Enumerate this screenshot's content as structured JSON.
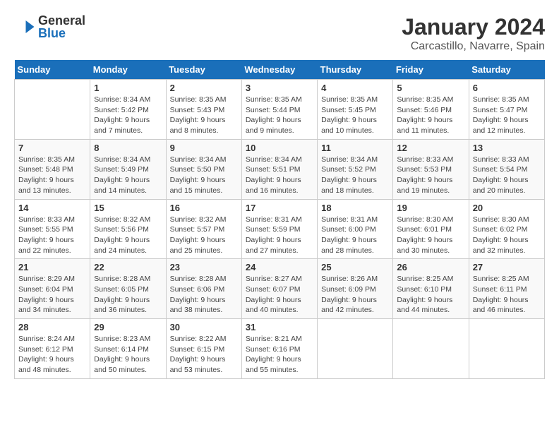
{
  "logo": {
    "general": "General",
    "blue": "Blue"
  },
  "title": "January 2024",
  "subtitle": "Carcastillo, Navarre, Spain",
  "days_header": [
    "Sunday",
    "Monday",
    "Tuesday",
    "Wednesday",
    "Thursday",
    "Friday",
    "Saturday"
  ],
  "weeks": [
    [
      {
        "num": "",
        "info": ""
      },
      {
        "num": "1",
        "info": "Sunrise: 8:34 AM\nSunset: 5:42 PM\nDaylight: 9 hours\nand 7 minutes."
      },
      {
        "num": "2",
        "info": "Sunrise: 8:35 AM\nSunset: 5:43 PM\nDaylight: 9 hours\nand 8 minutes."
      },
      {
        "num": "3",
        "info": "Sunrise: 8:35 AM\nSunset: 5:44 PM\nDaylight: 9 hours\nand 9 minutes."
      },
      {
        "num": "4",
        "info": "Sunrise: 8:35 AM\nSunset: 5:45 PM\nDaylight: 9 hours\nand 10 minutes."
      },
      {
        "num": "5",
        "info": "Sunrise: 8:35 AM\nSunset: 5:46 PM\nDaylight: 9 hours\nand 11 minutes."
      },
      {
        "num": "6",
        "info": "Sunrise: 8:35 AM\nSunset: 5:47 PM\nDaylight: 9 hours\nand 12 minutes."
      }
    ],
    [
      {
        "num": "7",
        "info": "Sunrise: 8:35 AM\nSunset: 5:48 PM\nDaylight: 9 hours\nand 13 minutes."
      },
      {
        "num": "8",
        "info": "Sunrise: 8:34 AM\nSunset: 5:49 PM\nDaylight: 9 hours\nand 14 minutes."
      },
      {
        "num": "9",
        "info": "Sunrise: 8:34 AM\nSunset: 5:50 PM\nDaylight: 9 hours\nand 15 minutes."
      },
      {
        "num": "10",
        "info": "Sunrise: 8:34 AM\nSunset: 5:51 PM\nDaylight: 9 hours\nand 16 minutes."
      },
      {
        "num": "11",
        "info": "Sunrise: 8:34 AM\nSunset: 5:52 PM\nDaylight: 9 hours\nand 18 minutes."
      },
      {
        "num": "12",
        "info": "Sunrise: 8:33 AM\nSunset: 5:53 PM\nDaylight: 9 hours\nand 19 minutes."
      },
      {
        "num": "13",
        "info": "Sunrise: 8:33 AM\nSunset: 5:54 PM\nDaylight: 9 hours\nand 20 minutes."
      }
    ],
    [
      {
        "num": "14",
        "info": "Sunrise: 8:33 AM\nSunset: 5:55 PM\nDaylight: 9 hours\nand 22 minutes."
      },
      {
        "num": "15",
        "info": "Sunrise: 8:32 AM\nSunset: 5:56 PM\nDaylight: 9 hours\nand 24 minutes."
      },
      {
        "num": "16",
        "info": "Sunrise: 8:32 AM\nSunset: 5:57 PM\nDaylight: 9 hours\nand 25 minutes."
      },
      {
        "num": "17",
        "info": "Sunrise: 8:31 AM\nSunset: 5:59 PM\nDaylight: 9 hours\nand 27 minutes."
      },
      {
        "num": "18",
        "info": "Sunrise: 8:31 AM\nSunset: 6:00 PM\nDaylight: 9 hours\nand 28 minutes."
      },
      {
        "num": "19",
        "info": "Sunrise: 8:30 AM\nSunset: 6:01 PM\nDaylight: 9 hours\nand 30 minutes."
      },
      {
        "num": "20",
        "info": "Sunrise: 8:30 AM\nSunset: 6:02 PM\nDaylight: 9 hours\nand 32 minutes."
      }
    ],
    [
      {
        "num": "21",
        "info": "Sunrise: 8:29 AM\nSunset: 6:04 PM\nDaylight: 9 hours\nand 34 minutes."
      },
      {
        "num": "22",
        "info": "Sunrise: 8:28 AM\nSunset: 6:05 PM\nDaylight: 9 hours\nand 36 minutes."
      },
      {
        "num": "23",
        "info": "Sunrise: 8:28 AM\nSunset: 6:06 PM\nDaylight: 9 hours\nand 38 minutes."
      },
      {
        "num": "24",
        "info": "Sunrise: 8:27 AM\nSunset: 6:07 PM\nDaylight: 9 hours\nand 40 minutes."
      },
      {
        "num": "25",
        "info": "Sunrise: 8:26 AM\nSunset: 6:09 PM\nDaylight: 9 hours\nand 42 minutes."
      },
      {
        "num": "26",
        "info": "Sunrise: 8:25 AM\nSunset: 6:10 PM\nDaylight: 9 hours\nand 44 minutes."
      },
      {
        "num": "27",
        "info": "Sunrise: 8:25 AM\nSunset: 6:11 PM\nDaylight: 9 hours\nand 46 minutes."
      }
    ],
    [
      {
        "num": "28",
        "info": "Sunrise: 8:24 AM\nSunset: 6:12 PM\nDaylight: 9 hours\nand 48 minutes."
      },
      {
        "num": "29",
        "info": "Sunrise: 8:23 AM\nSunset: 6:14 PM\nDaylight: 9 hours\nand 50 minutes."
      },
      {
        "num": "30",
        "info": "Sunrise: 8:22 AM\nSunset: 6:15 PM\nDaylight: 9 hours\nand 53 minutes."
      },
      {
        "num": "31",
        "info": "Sunrise: 8:21 AM\nSunset: 6:16 PM\nDaylight: 9 hours\nand 55 minutes."
      },
      {
        "num": "",
        "info": ""
      },
      {
        "num": "",
        "info": ""
      },
      {
        "num": "",
        "info": ""
      }
    ]
  ]
}
